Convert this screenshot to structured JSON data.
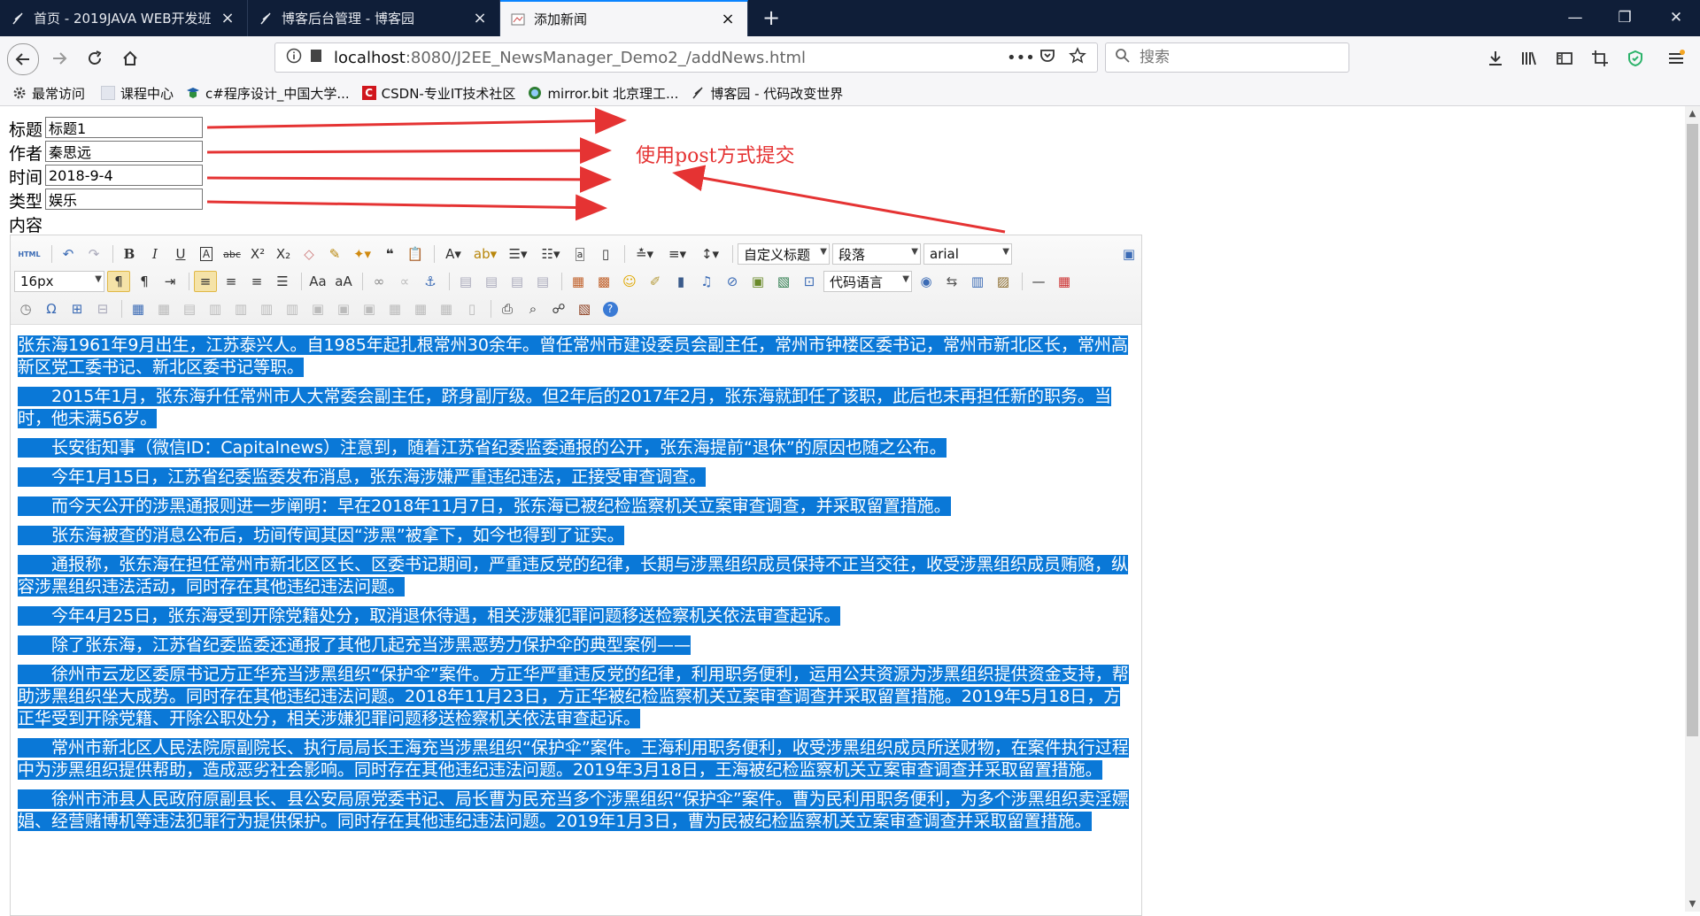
{
  "tabs": [
    {
      "title": "首页 - 2019JAVA WEB开发班",
      "active": false
    },
    {
      "title": "博客后台管理 - 博客园",
      "active": false
    },
    {
      "title": "添加新闻",
      "active": true
    }
  ],
  "window_controls": {
    "minimize": "—",
    "restore": "❐",
    "close": "✕"
  },
  "address": {
    "host": "localhost",
    "path": ":8080/J2EE_NewsManager_Demo2_/addNews.html"
  },
  "search": {
    "placeholder": "搜索"
  },
  "bookmarks": [
    "最常访问",
    "课程中心",
    "c#程序设计_中国大学...",
    "CSDN-专业IT技术社区",
    "mirror.bit 北京理工...",
    "博客园 - 代码改变世界"
  ],
  "form": {
    "title_label": "标题",
    "title_value": "标题1",
    "author_label": "作者",
    "author_value": "秦思远",
    "time_label": "时间",
    "time_value": "2018-9-4",
    "type_label": "类型",
    "type_value": "娱乐",
    "content_label": "内容"
  },
  "annotation": "使用post方式提交",
  "editor": {
    "html_label": "HTML",
    "heading_combo": "自定义标题",
    "paragraph_combo": "段落",
    "font_combo": "arial",
    "size_combo": "16px",
    "code_lang_combo": "代码语言",
    "paragraphs": [
      "张东海1961年9月出生，江苏泰兴人。自1985年起扎根常州30余年。曾任常州市建设委员会副主任，常州市钟楼区委书记，常州市新北区长，常州高新区党工委书记、新北区委书记等职。",
      "　　2015年1月，张东海升任常州市人大常委会副主任，跻身副厅级。但2年后的2017年2月，张东海就卸任了该职，此后也未再担任新的职务。当时，他未满56岁。",
      "　　长安街知事（微信ID：Capitalnews）注意到，随着江苏省纪委监委通报的公开，张东海提前“退休”的原因也随之公布。",
      "　　今年1月15日，江苏省纪委监委发布消息，张东海涉嫌严重违纪违法，正接受审查调查。",
      "　　而今天公开的涉黑通报则进一步阐明：早在2018年11月7日，张东海已被纪检监察机关立案审查调查，并采取留置措施。",
      "　　张东海被查的消息公布后，坊间传闻其因“涉黑”被拿下，如今也得到了证实。",
      "　　通报称，张东海在担任常州市新北区区长、区委书记期间，严重违反党的纪律，长期与涉黑组织成员保持不正当交往，收受涉黑组织成员贿赂，纵容涉黑组织违法活动，同时存在其他违纪违法问题。",
      "　　今年4月25日，张东海受到开除党籍处分，取消退休待遇，相关涉嫌犯罪问题移送检察机关依法审查起诉。",
      "　　除了张东海，江苏省纪委监委还通报了其他几起充当涉黑恶势力保护伞的典型案例——",
      "　　徐州市云龙区委原书记方正华充当涉黑组织“保护伞”案件。方正华严重违反党的纪律，利用职务便利，运用公共资源为涉黑组织提供资金支持，帮助涉黑组织坐大成势。同时存在其他违纪违法问题。2018年11月23日，方正华被纪检监察机关立案审查调查并采取留置措施。2019年5月18日，方正华受到开除党籍、开除公职处分，相关涉嫌犯罪问题移送检察机关依法审查起诉。",
      "　　常州市新北区人民法院原副院长、执行局局长王海充当涉黑组织“保护伞”案件。王海利用职务便利，收受涉黑组织成员所送财物，在案件执行过程中为涉黑组织提供帮助，造成恶劣社会影响。同时存在其他违纪违法问题。2019年3月18日，王海被纪检监察机关立案审查调查并采取留置措施。",
      "　　徐州市沛县人民政府原副县长、县公安局原党委书记、局长曹为民充当多个涉黑组织“保护伞”案件。曹为民利用职务便利，为多个涉黑组织卖淫嫖娼、经营赌博机等违法犯罪行为提供保护。同时存在其他违纪违法问题。2019年1月3日，曹为民被纪检监察机关立案审查调查并采取留置措施。"
    ]
  },
  "colors": {
    "tab_bg": "#0f1e38",
    "accent": "#0a84ff",
    "selection": "#0a78d7",
    "annotation": "#e53333"
  }
}
